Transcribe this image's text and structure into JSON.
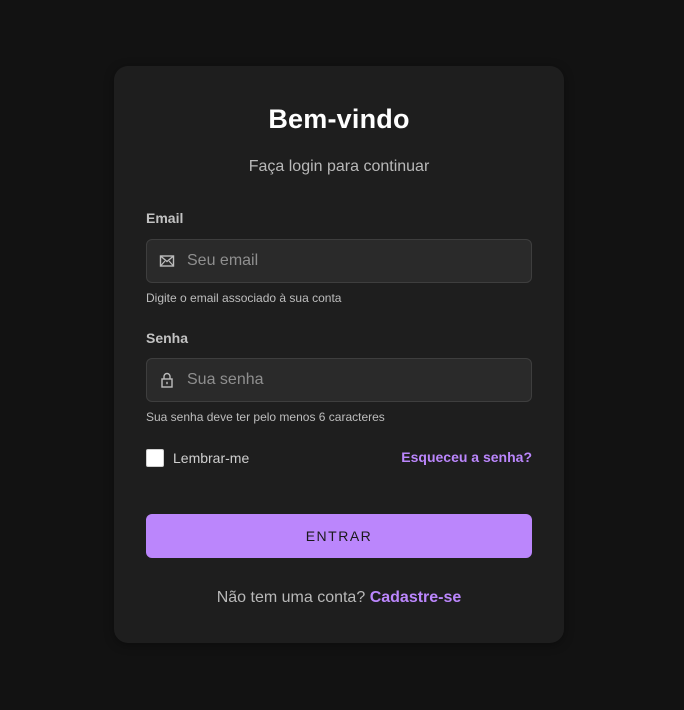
{
  "login": {
    "title": "Bem-vindo",
    "subtitle": "Faça login para continuar",
    "email": {
      "label": "Email",
      "value": "",
      "placeholder": "Seu email",
      "icon": "envelope-icon",
      "helper": "Digite o email associado à sua conta"
    },
    "password": {
      "label": "Senha",
      "value": "",
      "placeholder": "Sua senha",
      "icon": "lock-icon",
      "helper": "Sua senha deve ter pelo menos 6 caracteres"
    },
    "remember": {
      "label": "Lembrar-me",
      "checked": false
    },
    "forgot_link": "Esqueceu a senha?",
    "submit_label": "ENTRAR",
    "signup_prompt": "Não tem uma conta?",
    "signup_link": "Cadastre-se"
  },
  "colors": {
    "background": "#121212",
    "card": "#1e1e1e",
    "accent": "#bb86fc",
    "input_background": "#2a2a2a"
  }
}
